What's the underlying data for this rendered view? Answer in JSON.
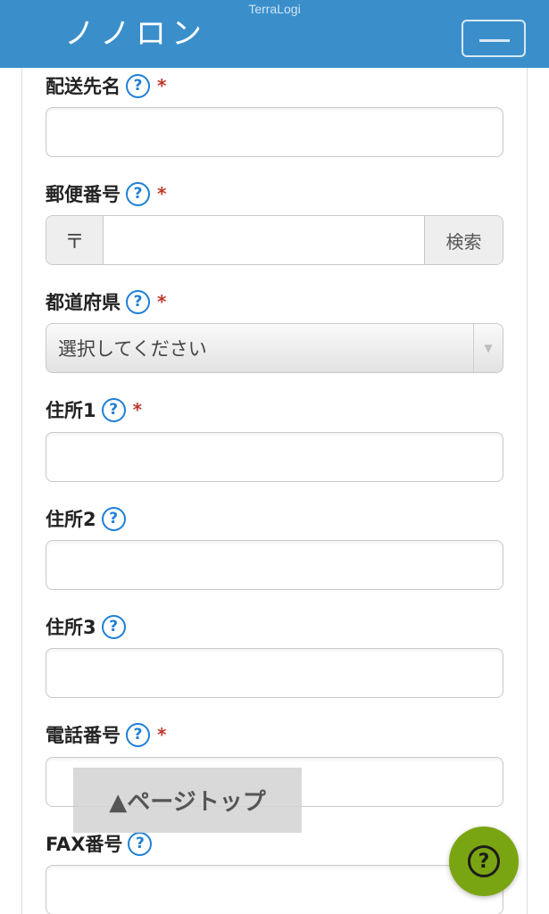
{
  "header": {
    "brand": "TerraLogi",
    "title": "ノノロン"
  },
  "fields": {
    "delivery_name": {
      "label": "配送先名",
      "required_mark": "*",
      "value": ""
    },
    "postal_code": {
      "label": "郵便番号",
      "required_mark": "*",
      "prefix": "〒",
      "search_label": "検索",
      "value": ""
    },
    "prefecture": {
      "label": "都道府県",
      "required_mark": "*",
      "selected": "選択してください"
    },
    "address1": {
      "label": "住所1",
      "required_mark": "*",
      "value": ""
    },
    "address2": {
      "label": "住所2",
      "value": ""
    },
    "address3": {
      "label": "住所3",
      "value": ""
    },
    "phone": {
      "label": "電話番号",
      "required_mark": "*",
      "value": ""
    },
    "fax": {
      "label": "FAX番号",
      "value": ""
    }
  },
  "help_glyph": "?",
  "page_top_label": "▲ページトップ",
  "icons": {
    "help": "question-circle-icon",
    "select_arrow": "▼"
  },
  "colors": {
    "header_bg": "#3a8fcb",
    "help_icon": "#1e7fd6",
    "required": "#c0392b",
    "fab_bg": "#7aa512"
  }
}
